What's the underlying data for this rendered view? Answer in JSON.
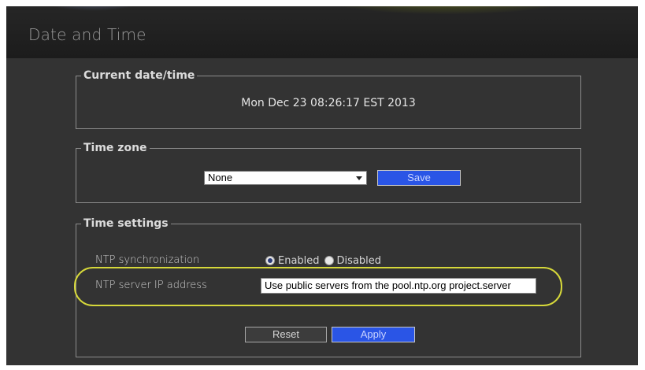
{
  "header": {
    "title": "Date and Time"
  },
  "current_datetime": {
    "legend": "Current date/time",
    "value": "Mon Dec 23 08:26:17 EST 2013"
  },
  "time_zone": {
    "legend": "Time zone",
    "selected": "None",
    "save_label": "Save"
  },
  "time_settings": {
    "legend": "Time settings",
    "ntp_sync_label": "NTP synchronization",
    "enabled_label": "Enabled",
    "disabled_label": "Disabled",
    "ntp_enabled": true,
    "ntp_server_label": "NTP server IP address",
    "ntp_server_value": "Use public servers from the pool.ntp.org project.server",
    "reset_label": "Reset",
    "apply_label": "Apply"
  },
  "colors": {
    "panel_bg": "#333333",
    "accent_button": "#2a55e6",
    "highlight": "#d6d83a"
  }
}
